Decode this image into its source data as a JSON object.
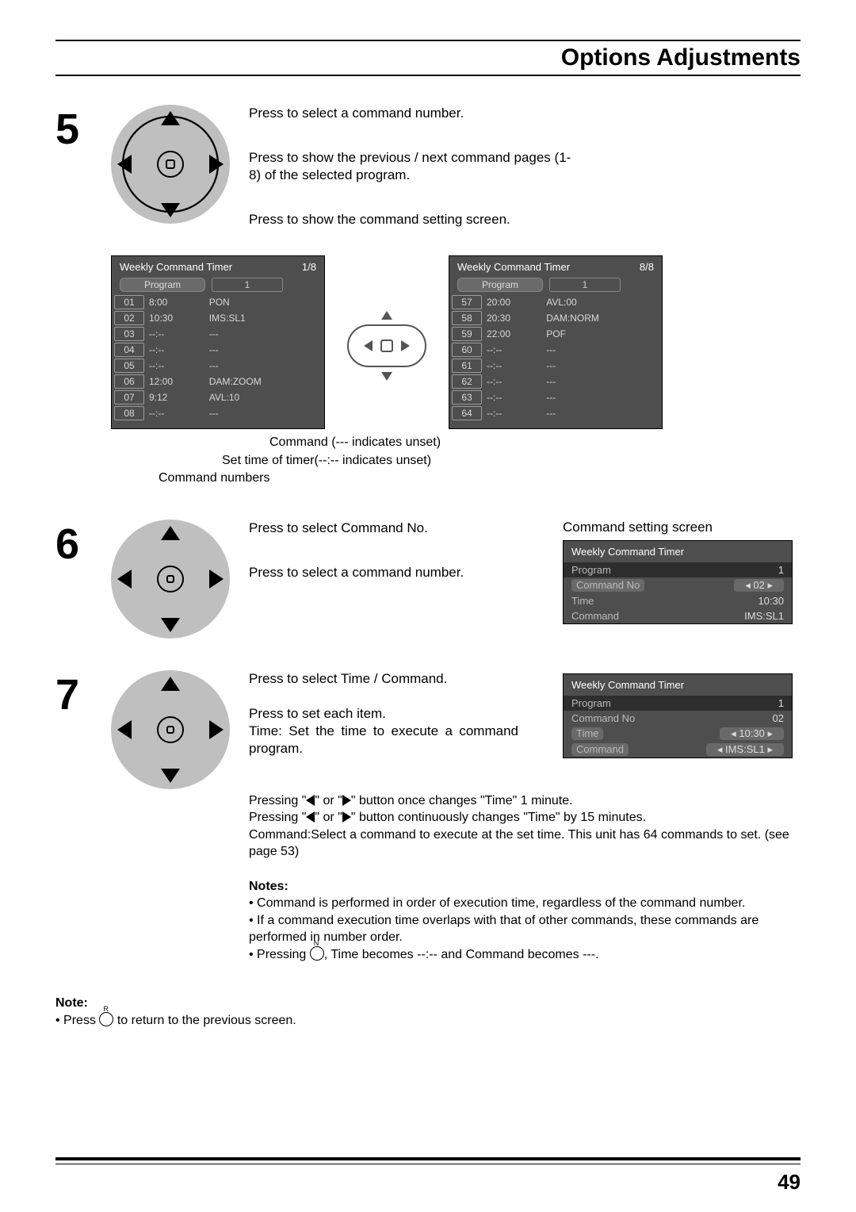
{
  "title": "Options Adjustments",
  "page_number": "49",
  "step5": {
    "num": "5",
    "line1": "Press to select a command number.",
    "line2": "Press to show the previous / next command pages (1-8) of the selected program.",
    "line3": "Press to show the command setting screen.",
    "panel_left": {
      "header": "Weekly Command Timer",
      "page": "1/8",
      "program_label": "Program",
      "program_value": "1",
      "rows": [
        {
          "n": "01",
          "t": "8:00",
          "c": "PON"
        },
        {
          "n": "02",
          "t": "10:30",
          "c": "IMS:SL1"
        },
        {
          "n": "03",
          "t": "--:--",
          "c": "---"
        },
        {
          "n": "04",
          "t": "--:--",
          "c": "---"
        },
        {
          "n": "05",
          "t": "--:--",
          "c": "---"
        },
        {
          "n": "06",
          "t": "12:00",
          "c": "DAM:ZOOM"
        },
        {
          "n": "07",
          "t": "9:12",
          "c": "AVL:10"
        },
        {
          "n": "08",
          "t": "--:--",
          "c": "---"
        }
      ]
    },
    "panel_right": {
      "header": "Weekly Command Timer",
      "page": "8/8",
      "program_label": "Program",
      "program_value": "1",
      "rows": [
        {
          "n": "57",
          "t": "20:00",
          "c": "AVL:00"
        },
        {
          "n": "58",
          "t": "20:30",
          "c": "DAM:NORM"
        },
        {
          "n": "59",
          "t": "22:00",
          "c": "POF"
        },
        {
          "n": "60",
          "t": "--:--",
          "c": "---"
        },
        {
          "n": "61",
          "t": "--:--",
          "c": "---"
        },
        {
          "n": "62",
          "t": "--:--",
          "c": "---"
        },
        {
          "n": "63",
          "t": "--:--",
          "c": "---"
        },
        {
          "n": "64",
          "t": "--:--",
          "c": "---"
        }
      ]
    },
    "callout1": "Command (--- indicates unset)",
    "callout2": "Set time of timer(--:-- indicates unset)",
    "callout3": "Command numbers"
  },
  "step6": {
    "num": "6",
    "line1": "Press to select Command No.",
    "line2": "Press to select a command number.",
    "heading": "Command setting screen",
    "panel": {
      "header": "Weekly Command Timer",
      "prg_label": "Program",
      "prg_val": "1",
      "cmdno_label": "Command No",
      "cmdno_val": "02",
      "time_label": "Time",
      "time_val": "10:30",
      "cmd_label": "Command",
      "cmd_val": "IMS:SL1"
    }
  },
  "step7": {
    "num": "7",
    "line1": "Press to select Time / Command.",
    "line2a": "Press to set each item.",
    "line2b": "Time: Set the time to execute a command program.",
    "line3a": "Pressing \" ◀ \" or \" ▶ \" button once changes \"Time\" 1 minute.",
    "line3b": "Pressing \" ◀ \" or \" ▶ \" button continuously changes \"Time\" by 15 minutes.",
    "line4": "Command:Select a command to execute at the set time. This unit has 64 commands to set. (see page 53)",
    "panel": {
      "header": "Weekly Command Timer",
      "prg_label": "Program",
      "prg_val": "1",
      "cmdno_label": "Command No",
      "cmdno_val": "02",
      "time_label": "Time",
      "time_val": "10:30",
      "cmd_label": "Command",
      "cmd_val": "IMS:SL1"
    },
    "notes_heading": "Notes:",
    "note1": "Command is performed in order of execution time, regardless of the command number.",
    "note2": "If a command execution time overlaps with that of other commands, these commands are performed in number order.",
    "note3a": "Pressing ",
    "note3b": ", Time becomes --:-- and Command becomes ---."
  },
  "bottom_note_heading": "Note:",
  "bottom_note_a": "Press ",
  "bottom_note_b": " to return to the previous screen."
}
